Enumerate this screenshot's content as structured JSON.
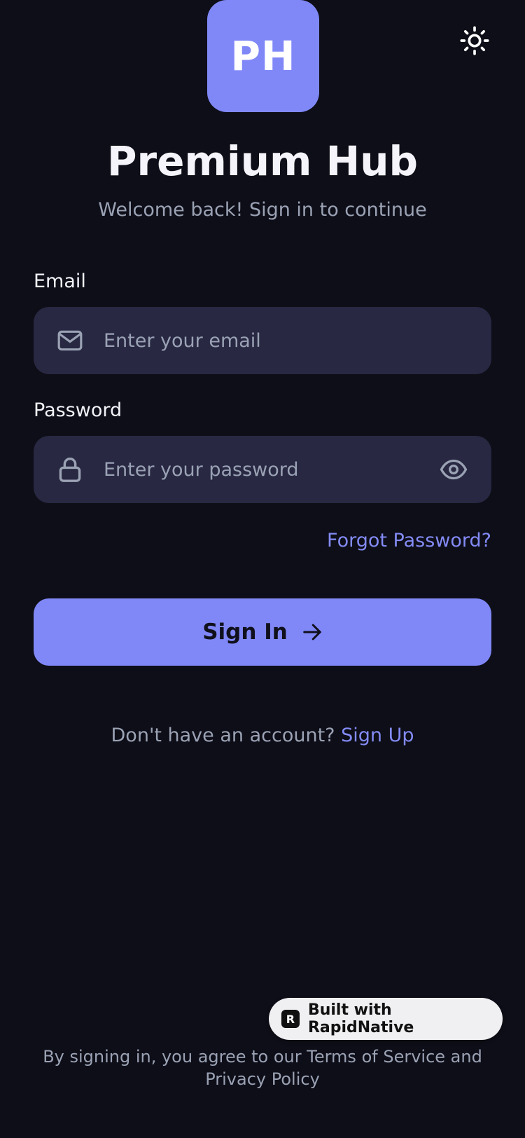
{
  "app": {
    "logo_initials": "PH",
    "title": "Premium Hub",
    "subtitle": "Welcome back! Sign in to continue"
  },
  "form": {
    "email": {
      "label": "Email",
      "placeholder": "Enter your email",
      "value": "",
      "icon": "mail-icon"
    },
    "password": {
      "label": "Password",
      "placeholder": "Enter your password",
      "value": "",
      "icon": "lock-icon",
      "toggle_icon": "eye-icon"
    },
    "forgot_label": "Forgot Password?",
    "submit_label": "Sign In",
    "submit_icon": "arrow-right-icon"
  },
  "signup": {
    "prompt": "Don't have an account?",
    "link_label": "Sign Up"
  },
  "badge": {
    "icon_letter": "R",
    "label": "Built with RapidNative"
  },
  "legal": {
    "text": "By signing in, you agree to our Terms of Service and Privacy Policy"
  },
  "theme": {
    "toggle_icon": "sun-icon",
    "background": "#0e0e18",
    "surface": "#282843",
    "accent": "#8088f8",
    "link": "#838bf5",
    "muted_text": "#9aa2b4"
  }
}
